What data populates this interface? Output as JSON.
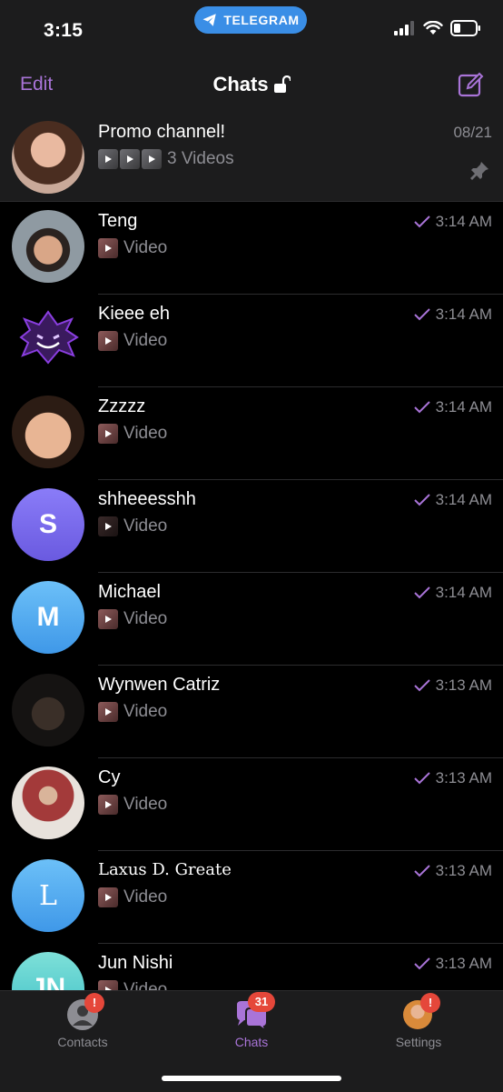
{
  "status_bar": {
    "time": "3:15",
    "banner": "TELEGRAM"
  },
  "nav": {
    "edit_label": "Edit",
    "title": "Chats"
  },
  "pinned": {
    "name": "Promo channel!",
    "preview": "3 Videos",
    "date": "08/21"
  },
  "chats": [
    {
      "name": "Teng",
      "preview": "Video",
      "time": "3:14 AM"
    },
    {
      "name": "Kieee eh",
      "preview": "Video",
      "time": "3:14 AM"
    },
    {
      "name": "Zzzzz",
      "preview": "Video",
      "time": "3:14 AM"
    },
    {
      "name": "shheeesshh",
      "preview": "Video",
      "time": "3:14 AM",
      "initials": "S"
    },
    {
      "name": "Michael",
      "preview": "Video",
      "time": "3:14 AM",
      "initials": "M"
    },
    {
      "name": "Wynwen Catriz",
      "preview": "Video",
      "time": "3:13 AM"
    },
    {
      "name": "Cy",
      "preview": "Video",
      "time": "3:13 AM"
    },
    {
      "name": "Laxus D. Greate",
      "preview": "Video",
      "time": "3:13 AM",
      "initials": "L"
    },
    {
      "name": "Jun Nishi",
      "preview": "Video",
      "time": "3:13 AM",
      "initials": "JN"
    }
  ],
  "tabs": {
    "contacts": {
      "label": "Contacts",
      "badge": "!"
    },
    "chats": {
      "label": "Chats",
      "badge": "31"
    },
    "settings": {
      "label": "Settings",
      "badge": "!"
    }
  },
  "colors": {
    "accent": "#a974d8",
    "read_check": "#a974d8",
    "badge": "#e5473a",
    "banner": "#3a8ee6"
  }
}
